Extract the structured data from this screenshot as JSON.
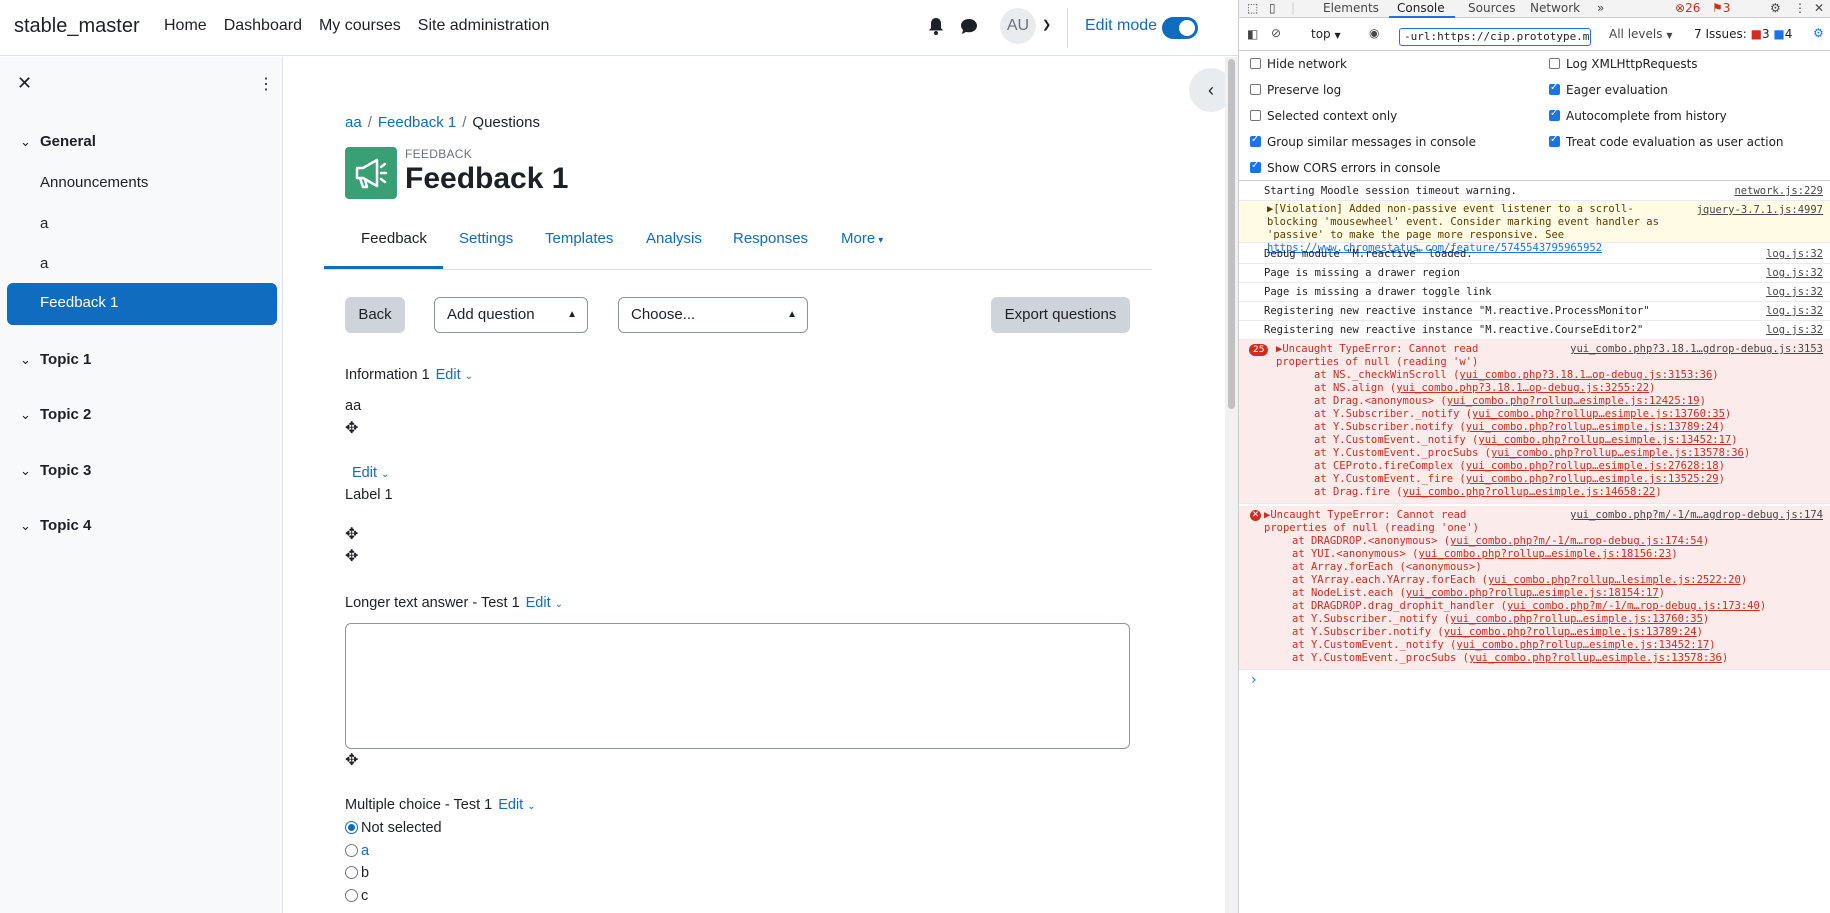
{
  "navbar": {
    "brand": "stable_master",
    "links": [
      "Home",
      "Dashboard",
      "My courses",
      "Site administration"
    ],
    "avatar": "AU",
    "edit_mode_label": "Edit mode"
  },
  "drawer": {
    "sections": [
      {
        "label": "General",
        "items": [
          "Announcements",
          "a",
          "a",
          "Feedback 1"
        ]
      },
      {
        "label": "Topic 1"
      },
      {
        "label": "Topic 2"
      },
      {
        "label": "Topic 3"
      },
      {
        "label": "Topic 4"
      }
    ],
    "selected_item": "Feedback 1"
  },
  "breadcrumb": {
    "items": [
      "aa",
      "Feedback 1"
    ],
    "current": "Questions"
  },
  "page": {
    "module_type": "FEEDBACK",
    "title": "Feedback 1"
  },
  "tabs": [
    "Feedback",
    "Settings",
    "Templates",
    "Analysis",
    "Responses",
    "More"
  ],
  "toolbar": {
    "back": "Back",
    "add_question": "Add question",
    "choose": "Choose...",
    "export": "Export questions"
  },
  "questions": {
    "info": {
      "label": "Information 1",
      "edit": "Edit",
      "value": "aa"
    },
    "label_item": {
      "edit": "Edit",
      "label": "Label 1"
    },
    "longer_text": {
      "label": "Longer text answer - Test 1",
      "edit": "Edit"
    },
    "multichoice": {
      "label": "Multiple choice - Test 1",
      "edit": "Edit",
      "options": [
        "Not selected",
        "a",
        "b",
        "c"
      ],
      "selected": "Not selected"
    }
  },
  "devtools": {
    "tabs": [
      "Elements",
      "Console",
      "Sources",
      "Network"
    ],
    "active_tab": "Console",
    "error_count": "26",
    "warning_count": "3",
    "context": "top",
    "filter": "-url:https://cip.prototype.moodle",
    "levels": "All levels",
    "issues_label": "7 Issues:",
    "issues_errors": "3",
    "issues_info": "4",
    "options_left": [
      "Hide network",
      "Preserve log",
      "Selected context only",
      "Group similar messages in console",
      "Show CORS errors in console"
    ],
    "options_right": [
      "Log XMLHttpRequests",
      "Eager evaluation",
      "Autocomplete from history",
      "Treat code evaluation as user action"
    ],
    "logs": [
      {
        "text": "Starting Moodle session timeout warning.",
        "src": "network.js:229"
      },
      {
        "text": "▶[Violation] Added non-passive event listener to a scroll-blocking 'mousewheel' event. Consider marking event handler as 'passive' to make the page more responsive. See",
        "link": "https://www.chromestatus.com/feature/5745543795965952",
        "src": "jquery-3.7.1.js:4997"
      },
      {
        "text": "Debug module \"M.reactive\" loaded.",
        "src": "log.js:32"
      },
      {
        "text": "Page is missing a drawer region",
        "src": "log.js:32"
      },
      {
        "text": "Page is missing a drawer toggle link",
        "src": "log.js:32"
      },
      {
        "text": "Registering new reactive instance \"M.reactive.ProcessMonitor\"",
        "src": "log.js:32"
      },
      {
        "text": "Registering new reactive instance \"M.reactive.CourseEditor2\"",
        "src": "log.js:32"
      }
    ],
    "error1": {
      "count": "25",
      "text": "▶Uncaught TypeError: Cannot read properties of null (reading 'w')",
      "src": "yui_combo.php?3.18.1…gdrop-debug.js:3153",
      "stack": [
        [
          "at NS._checkWinScroll (",
          "yui_combo.php?3.18.1…op-debug.js:3153:36",
          ")"
        ],
        [
          "at NS.align (",
          "yui_combo.php?3.18.1…op-debug.js:3255:22",
          ")"
        ],
        [
          "at Drag.<anonymous> (",
          "yui_combo.php?rollup…esimple.js:12425:19",
          ")"
        ],
        [
          "at Y.Subscriber._notify (",
          "yui_combo.php?rollup…esimple.js:13760:35",
          ")"
        ],
        [
          "at Y.Subscriber.notify (",
          "yui_combo.php?rollup…esimple.js:13789:24",
          ")"
        ],
        [
          "at Y.CustomEvent._notify (",
          "yui_combo.php?rollup…esimple.js:13452:17",
          ")"
        ],
        [
          "at Y.CustomEvent._procSubs (",
          "yui_combo.php?rollup…esimple.js:13578:36",
          ")"
        ],
        [
          "at CEProto.fireComplex (",
          "yui_combo.php?rollup…esimple.js:27628:18",
          ")"
        ],
        [
          "at Y.CustomEvent._fire (",
          "yui_combo.php?rollup…esimple.js:13525:29",
          ")"
        ],
        [
          "at Drag.fire (",
          "yui_combo.php?rollup…esimple.js:14658:22",
          ")"
        ]
      ]
    },
    "error2": {
      "text": "▶Uncaught TypeError: Cannot read properties of null (reading 'one')",
      "src": "yui_combo.php?m/-1/m…agdrop-debug.js:174",
      "stack": [
        [
          "at DRAGDROP.<anonymous> (",
          "yui_combo.php?m/-1/m…rop-debug.js:174:54",
          ")"
        ],
        [
          "at YUI.<anonymous> (",
          "yui_combo.php?rollup…esimple.js:18156:23",
          ")"
        ],
        [
          "at Array.forEach (<anonymous>)",
          "",
          ""
        ],
        [
          "at YArray.each.YArray.forEach (",
          "yui_combo.php?rollup…lesimple.js:2522:20",
          ")"
        ],
        [
          "at NodeList.each (",
          "yui_combo.php?rollup…esimple.js:18154:17",
          ")"
        ],
        [
          "at DRAGDROP.drag_drophit_handler (",
          "yui_combo.php?m/-1/m…rop-debug.js:173:40",
          ")"
        ],
        [
          "at Y.Subscriber._notify (",
          "yui_combo.php?rollup…esimple.js:13760:35",
          ")"
        ],
        [
          "at Y.Subscriber.notify (",
          "yui_combo.php?rollup…esimple.js:13789:24",
          ")"
        ],
        [
          "at Y.CustomEvent._notify (",
          "yui_combo.php?rollup…esimple.js:13452:17",
          ")"
        ],
        [
          "at Y.CustomEvent._procSubs (",
          "yui_combo.php?rollup…esimple.js:13578:36",
          ")"
        ]
      ]
    }
  }
}
